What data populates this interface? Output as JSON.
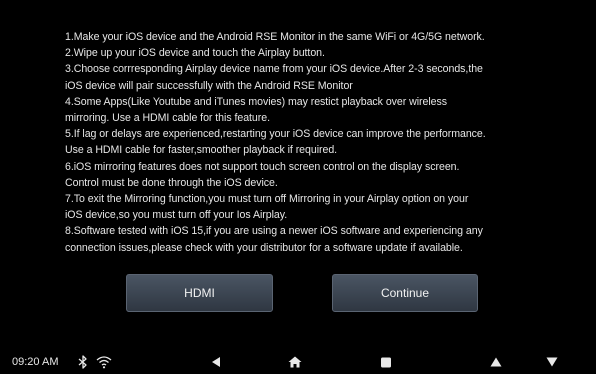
{
  "instructions": [
    "1.Make your iOS device and the Android RSE Monitor in the same WiFi or 4G/5G network.",
    "2.Wipe up your iOS device and touch the Airplay button.",
    "3.Choose corrresponding Airplay device name from your iOS device.After 2-3 seconds,the",
    "iOS device will pair successfully with the Android RSE Monitor",
    "4.Some Apps(Like Youtube and iTunes movies) may restict playback over wireless",
    "mirroring. Use a HDMI cable for this feature.",
    "5.If lag or delays are experienced,restarting your iOS device can improve the performance.",
    "Use a HDMI cable for faster,smoother playback if required.",
    "6.iOS mirroring features does not support touch screen control on the display screen.",
    "Control must be done through the iOS device.",
    "7.To exit the Mirroring function,you must turn off Mirroring in your Airplay option on your",
    "iOS device,so you must turn off your Ios Airplay.",
    "8.Software tested with iOS 15,if you are using a newer iOS software and experiencing any",
    "connection issues,please check with your distributor for a software update if available."
  ],
  "buttons": {
    "hdmi_label": "HDMI",
    "continue_label": "Continue"
  },
  "statusbar": {
    "time": "09:20 AM",
    "icons": [
      "bluetooth-icon",
      "wifi-icon"
    ]
  },
  "navbar": {
    "icons": [
      "back-icon",
      "home-icon",
      "recent-apps-icon",
      "volume-up-icon",
      "volume-down-icon"
    ]
  },
  "colors": {
    "background": "#000000",
    "text": "#e6e6e6",
    "button_fill": "#3b4450",
    "button_border": "#5a6472"
  }
}
